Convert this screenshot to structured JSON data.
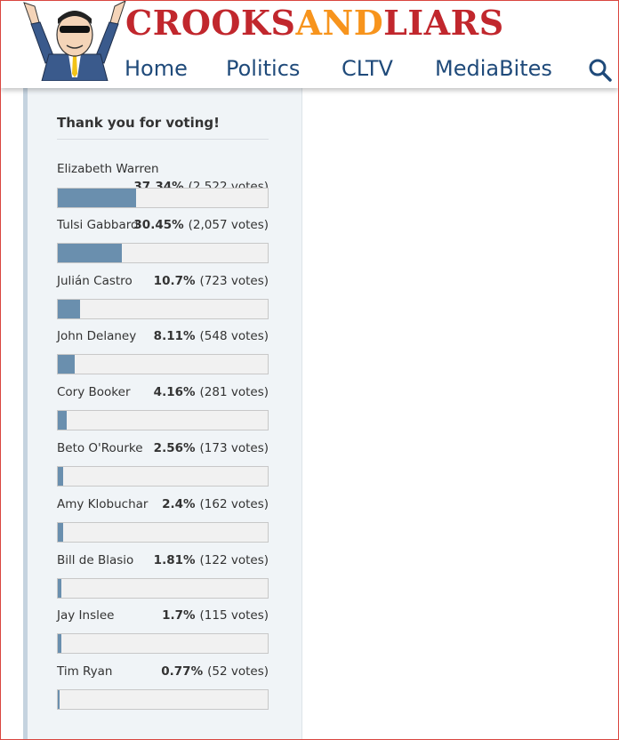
{
  "site": {
    "logo": {
      "part1": "CROOKS",
      "part2": "AND",
      "part3": "LIARS"
    },
    "nav": [
      "Home",
      "Politics",
      "CLTV",
      "MediaBites"
    ],
    "colors": {
      "logo_red": "#c1272d",
      "logo_orange": "#f7941d",
      "nav_blue": "#1f4a7a",
      "bar_fill": "#6a8fae"
    }
  },
  "poll": {
    "title": "Thank you for voting!",
    "answers": [
      {
        "name": "Elizabeth Warren",
        "percent": "37.34%",
        "votes": "(2,522 votes)",
        "fraction": 0.3734
      },
      {
        "name": "Tulsi Gabbard",
        "percent": "30.45%",
        "votes": "(2,057 votes)",
        "fraction": 0.3045
      },
      {
        "name": "Julián Castro",
        "percent": "10.7%",
        "votes": "(723 votes)",
        "fraction": 0.107
      },
      {
        "name": "John Delaney",
        "percent": "8.11%",
        "votes": "(548 votes)",
        "fraction": 0.0811
      },
      {
        "name": "Cory Booker",
        "percent": "4.16%",
        "votes": "(281 votes)",
        "fraction": 0.0416
      },
      {
        "name": "Beto O'Rourke",
        "percent": "2.56%",
        "votes": "(173 votes)",
        "fraction": 0.0256
      },
      {
        "name": "Amy Klobuchar",
        "percent": "2.4%",
        "votes": "(162 votes)",
        "fraction": 0.024
      },
      {
        "name": "Bill de Blasio",
        "percent": "1.81%",
        "votes": "(122 votes)",
        "fraction": 0.0181
      },
      {
        "name": "Jay Inslee",
        "percent": "1.7%",
        "votes": "(115 votes)",
        "fraction": 0.017
      },
      {
        "name": "Tim Ryan",
        "percent": "0.77%",
        "votes": "(52 votes)",
        "fraction": 0.0077
      }
    ]
  }
}
